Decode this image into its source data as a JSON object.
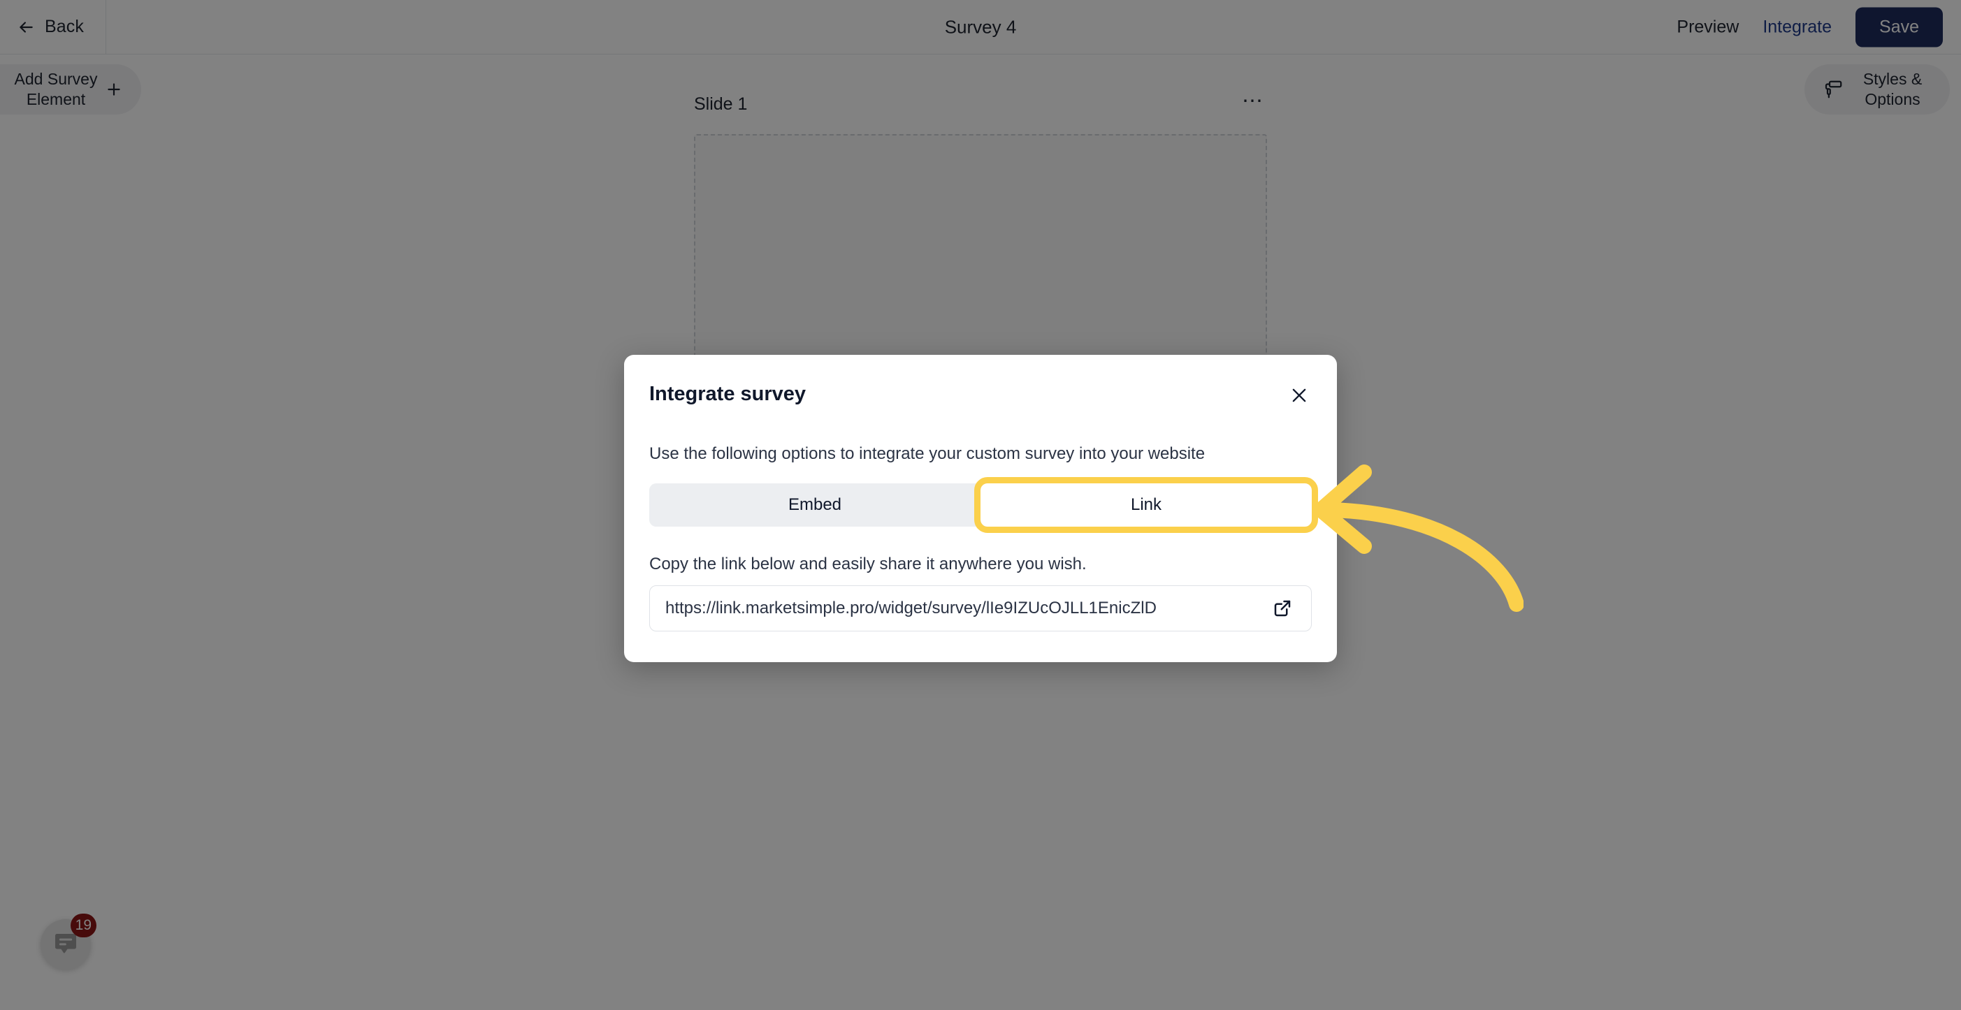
{
  "header": {
    "back_label": "Back",
    "back_icon": "arrow-left-icon",
    "title": "Survey 4",
    "preview_label": "Preview",
    "integrate_label": "Integrate",
    "save_label": "Save",
    "integrate_color": "#1e3a8a",
    "save_bg": "#1e2b5c"
  },
  "toolbar": {
    "add_element_label": "Add Survey Element",
    "add_element_icon": "plus-icon",
    "styles_options_label": "Styles & Options",
    "styles_options_icon": "paint-roller-icon"
  },
  "canvas": {
    "slide_title": "Slide 1",
    "slide_menu_label": "⋯",
    "slide_menu_icon": "ellipsis-icon"
  },
  "chat": {
    "badge_count": "19",
    "icon": "chat-bubble-icon",
    "badge_color": "#8c1616"
  },
  "modal": {
    "title": "Integrate survey",
    "close_icon": "close-icon",
    "subtitle": "Use the following options to integrate your custom survey into your website",
    "tabs": [
      {
        "label": "Embed",
        "active": false,
        "highlighted": false
      },
      {
        "label": "Link",
        "active": true,
        "highlighted": true
      }
    ],
    "copy_hint": "Copy the link below and easily share it anywhere you wish.",
    "link_value": "https://link.marketsimple.pro/widget/survey/lIe9IZUcOJLL1EnicZlD",
    "link_placeholder": "https://",
    "external_link_icon": "external-link-icon"
  },
  "annotation": {
    "arrow_icon": "curved-arrow-left-icon",
    "highlight_color": "#FBD04B"
  }
}
